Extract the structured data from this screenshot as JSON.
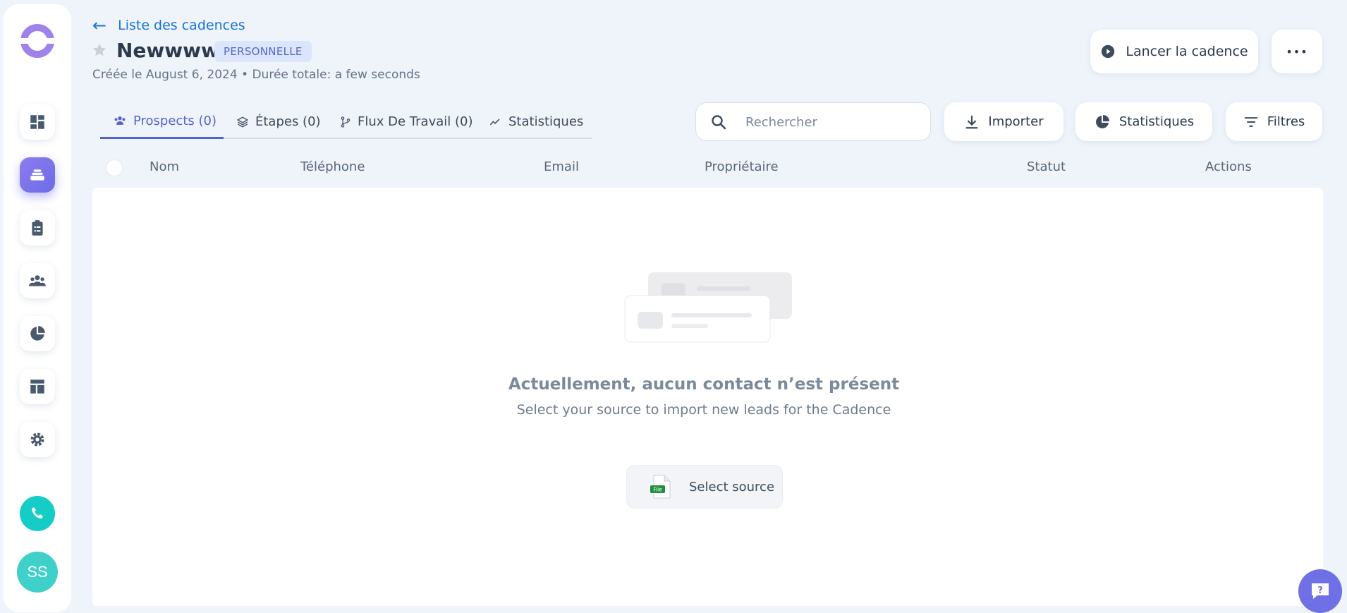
{
  "header": {
    "back_label": "Liste des cadences",
    "title": "Newwww",
    "tag": "PERSONNELLE",
    "meta": "Créée le August 6, 2024 • Durée totale: a few seconds",
    "launch_label": "Lancer la cadence",
    "more_label": "•••"
  },
  "sidebar": {
    "items": [
      {
        "icon": "dashboard-icon",
        "active": false
      },
      {
        "icon": "cadence-stack-icon",
        "active": true
      },
      {
        "icon": "tasks-clipboard-icon",
        "active": false
      },
      {
        "icon": "people-icon",
        "active": false
      },
      {
        "icon": "pie-chart-icon",
        "active": false
      },
      {
        "icon": "templates-layout-icon",
        "active": false
      },
      {
        "icon": "settings-gear-icon",
        "active": false
      }
    ],
    "avatar_initials": "SS"
  },
  "tabs": [
    {
      "label": "Prospects (0)",
      "icon": "people-icon",
      "active": true
    },
    {
      "label": "Étapes (0)",
      "icon": "layers-icon",
      "active": false
    },
    {
      "label": "Flux De Travail (0)",
      "icon": "workflow-icon",
      "active": false
    },
    {
      "label": "Statistiques",
      "icon": "trend-icon",
      "active": false
    }
  ],
  "toolbar": {
    "search_placeholder": "Rechercher",
    "import_label": "Importer",
    "stats_label": "Statistiques",
    "filters_label": "Filtres"
  },
  "table": {
    "columns": [
      "Nom",
      "Téléphone",
      "Email",
      "Propriétaire",
      "Statut",
      "Actions"
    ],
    "rows": []
  },
  "empty_state": {
    "title": "Actuellement, aucun contact n’est présent",
    "subtitle": "Select your source to import new leads for the Cadence",
    "button_label": "Select source",
    "file_badge": "File"
  },
  "colors": {
    "accent": "#5561cf",
    "link": "#1a73d9",
    "brand": "#9f83ea",
    "phone": "#16ccc7",
    "background": "#eef4fa"
  }
}
